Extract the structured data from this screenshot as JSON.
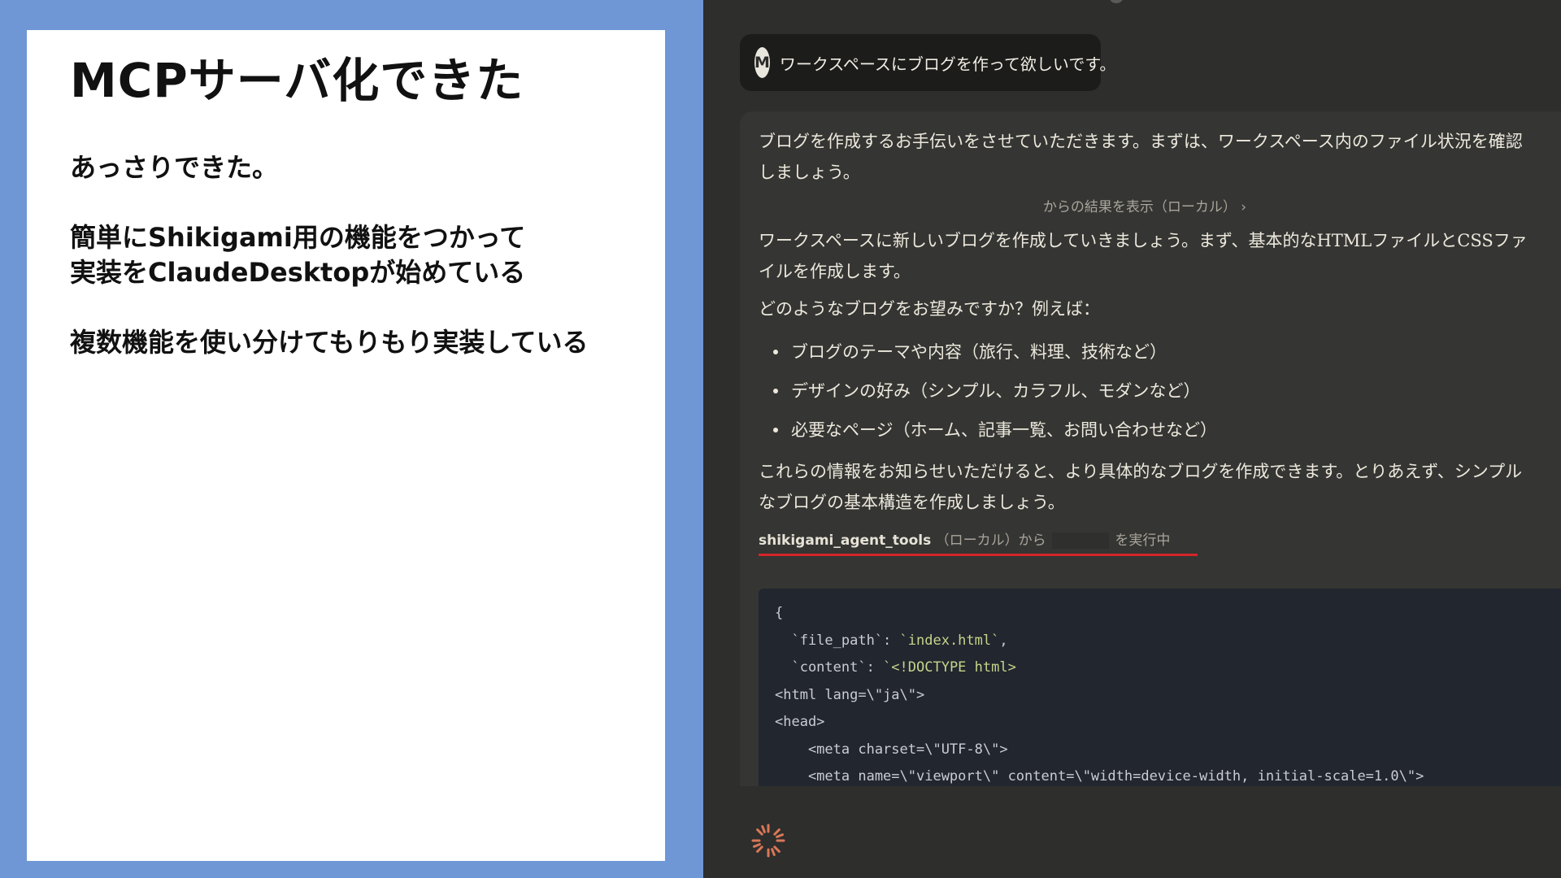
{
  "slide": {
    "title": "MCPサーバ化できた",
    "lines": [
      "あっさりできた。",
      "簡単にShikigami用の機能をつかって",
      "実装をClaudeDesktopが始めている",
      "複数機能を使い分けてもりもり実装している"
    ]
  },
  "chat": {
    "user": {
      "avatar_letter": "M",
      "message": "ワークスペースにブログを作って欲しいです。"
    },
    "assistant": {
      "intro": "ブログを作成するお手伝いをさせていただきます。まずは、ワークスペース内のファイル状況を確認しましょう。",
      "tool_result_link": "からの結果を表示（ローカル） ›",
      "para2": "ワークスペースに新しいブログを作成していきましょう。まず、基本的なHTMLファイルとCSSファイルを作成します。",
      "question": "どのようなブログをお望みですか？例えば：",
      "bullets": [
        "ブログのテーマや内容（旅行、料理、技術など）",
        "デザインの好み（シンプル、カラフル、モダンなど）",
        "必要なページ（ホーム、記事一覧、お問い合わせなど）"
      ],
      "para3": "これらの情報をお知らせいただけると、より具体的なブログを作成できます。とりあえず、シンプルなブログの基本構造を作成しましょう。",
      "tool_run": {
        "tool_name": "shikigami_agent_tools",
        "middle": "（ローカル）から",
        "suffix": "を実行中"
      },
      "code": {
        "l1": "{",
        "l2_key": "  `file_path`: ",
        "l2_val": "`index.html`",
        "l2_end": ",",
        "l3_key": "  `content`: ",
        "l3_val": "`<!DOCTYPE html>",
        "l4": "<html lang=\\\"ja\\\">",
        "l5": "<head>",
        "l6": "    <meta charset=\\\"UTF-8\\\">",
        "l7": "    <meta name=\\\"viewport\\\" content=\\\"width=device-width, initial-scale=1.0\\\">"
      }
    },
    "colors": {
      "accent_underline": "#d3252a",
      "spinner": "#d97757"
    },
    "icons": {
      "loading": "spinner-icon"
    }
  }
}
